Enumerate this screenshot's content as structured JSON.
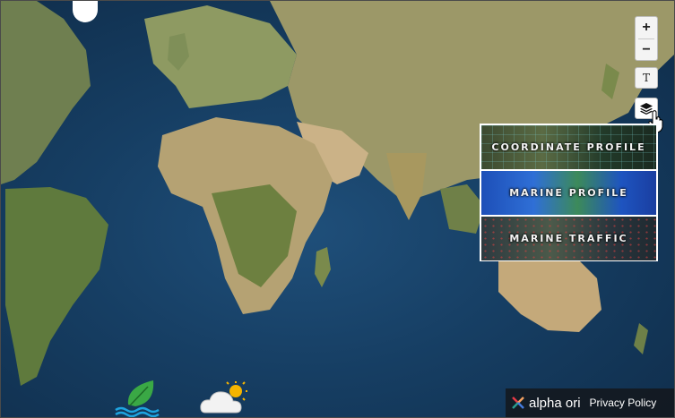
{
  "map": {
    "zoom_in_label": "+",
    "zoom_out_label": "−",
    "text_toggle_label": "T",
    "layers_icon": "layers-icon"
  },
  "layer_panel": {
    "layers": [
      {
        "label": "COORDINATE PROFILE"
      },
      {
        "label": "MARINE PROFILE"
      },
      {
        "label": "MARINE TRAFFIC"
      }
    ]
  },
  "footer": {
    "brand": "alpha ori",
    "privacy": "Privacy Policy"
  },
  "icons": {
    "eco": "leaf-water-icon",
    "weather": "sun-cloud-icon"
  },
  "colors": {
    "ocean": "#163e63",
    "land": "#7d8a55",
    "desert": "#c9b58a",
    "eco_green": "#3aa845",
    "water_blue": "#1ea4e0"
  }
}
